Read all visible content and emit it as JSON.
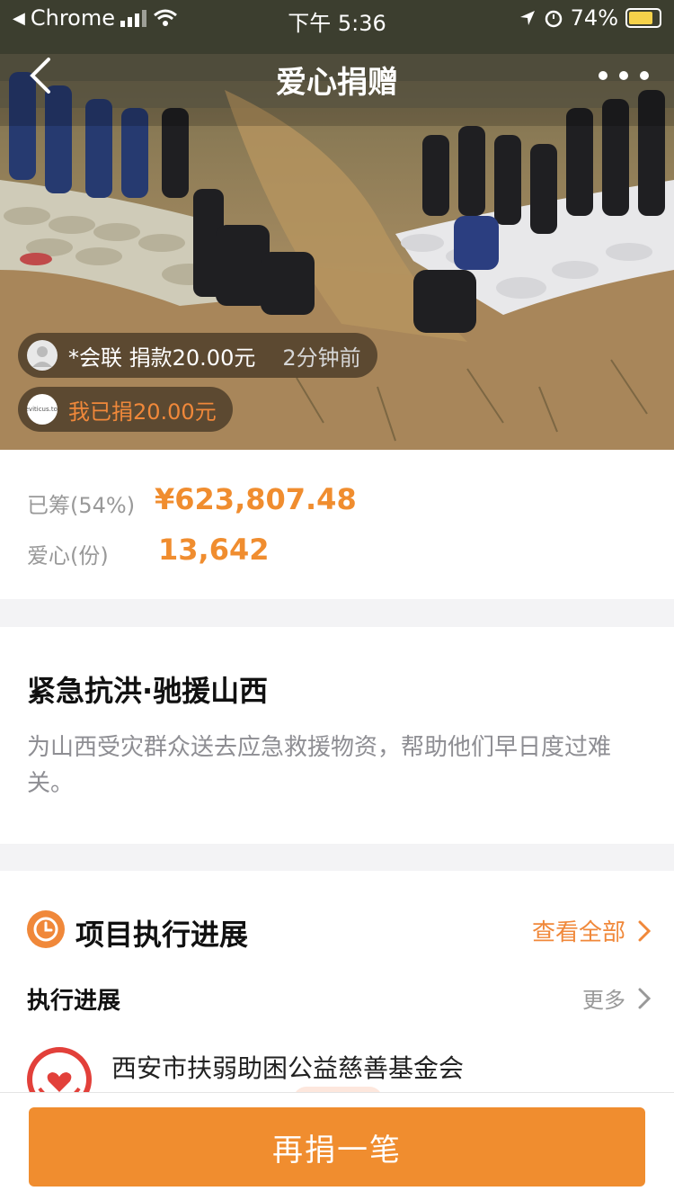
{
  "status_bar": {
    "back_app": "Chrome",
    "time": "下午 5:36",
    "battery": "74%"
  },
  "nav": {
    "title": "爱心捐赠"
  },
  "feed": [
    {
      "name": "*会联 捐款20.00元",
      "time": "2分钟前"
    },
    {
      "name": "我已捐20.00元",
      "avatar_text": "leviticus.top"
    }
  ],
  "stats": {
    "raised_label": "已筹(54%)",
    "raised_value": "¥623,807.48",
    "hearts_label": "爱心(份)",
    "hearts_value": "13,642"
  },
  "project": {
    "title": "紧急抗洪·驰援山西",
    "description": "为山西受灾群众送去应急救援物资，帮助他们早日度过难关。"
  },
  "progress": {
    "section_title": "项目执行进展",
    "view_all": "查看全部",
    "sub_title": "执行进展",
    "more": "更多",
    "org_name": "西安市扶弱助困公益慈善基金会"
  },
  "footer": {
    "donate_again": "再捐一笔"
  },
  "colors": {
    "accent": "#f08d2f",
    "muted": "#999999"
  }
}
